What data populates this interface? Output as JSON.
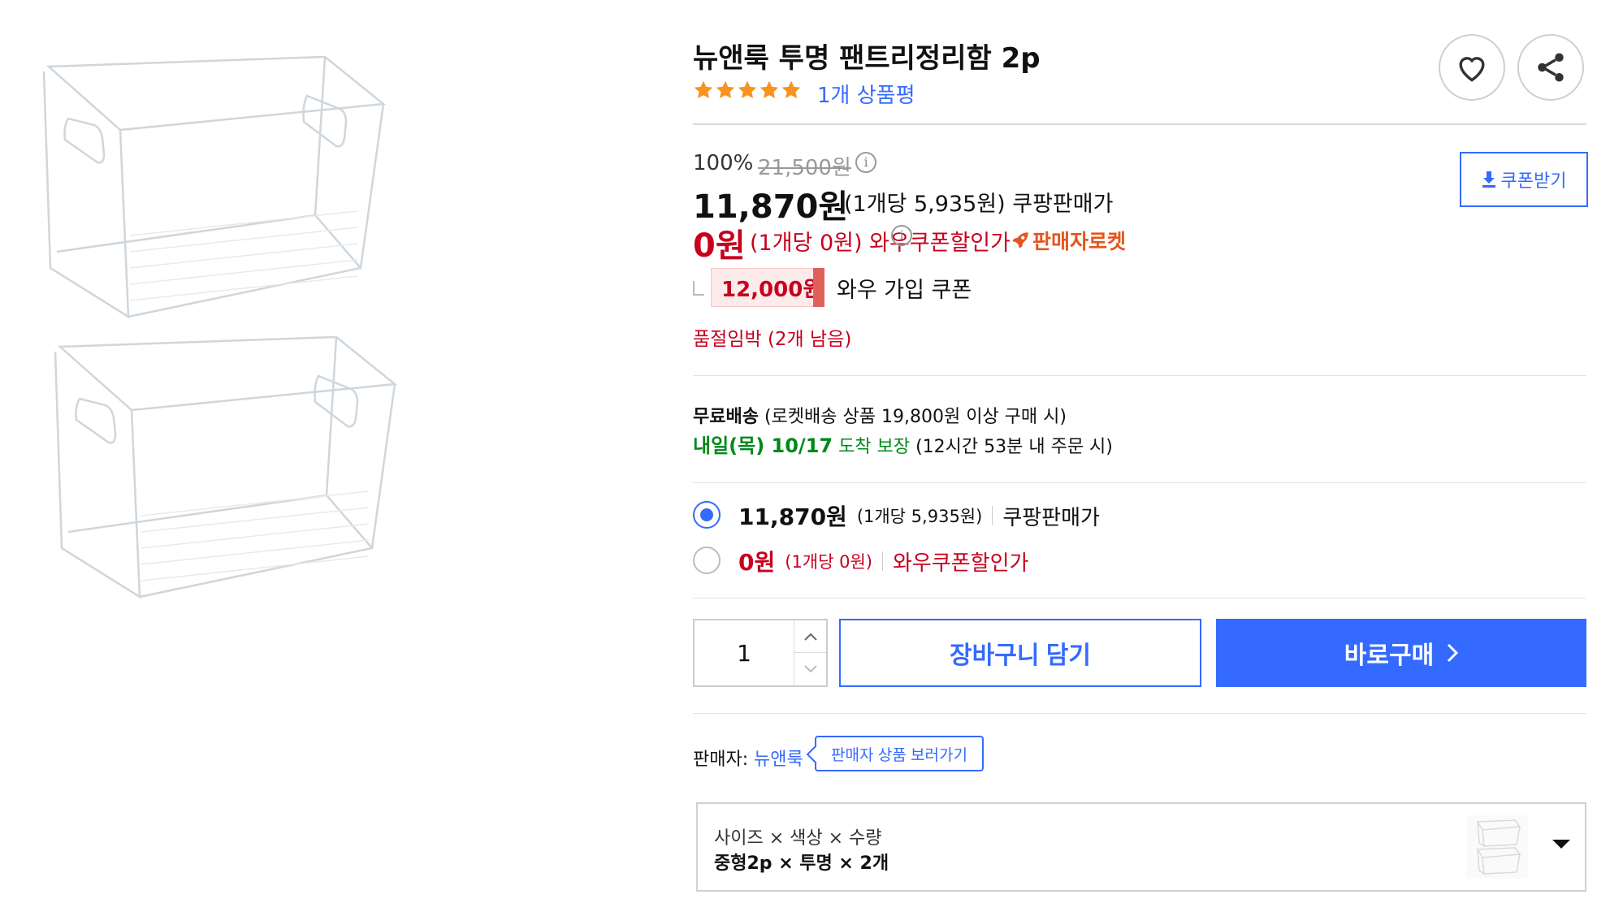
{
  "product": {
    "title": "뉴앤룩 투명 팬트리정리함 2p",
    "review_count_label": "1개 상품평",
    "rating": 5
  },
  "actions": {
    "like_icon": "heart-icon",
    "share_icon": "share-icon"
  },
  "pricing": {
    "discount_rate": "100%",
    "original_price": "21,500원",
    "sale_price": "11,870원",
    "sale_unit_price": "(1개당 5,935원) 쿠팡판매가",
    "wow_price": "0원",
    "wow_unit_price": "(1개당 0원) 와우쿠폰할인가",
    "rocket_badge": "판매자로켓",
    "coupon_button": "쿠폰받기",
    "wow_coupon_amount": "12,000원",
    "wow_coupon_label": "와우 가입 쿠폰",
    "stock_notice": "품절임박 (2개 남음)"
  },
  "shipping": {
    "free_label": "무료배송",
    "free_condition": "(로켓배송 상품 19,800원 이상 구매 시)",
    "arrival_date": "내일(목) 10/17",
    "arrival_guarantee": "도착 보장",
    "order_deadline": "(12시간 53분 내 주문 시)"
  },
  "price_options": [
    {
      "price": "11,870원",
      "unit": "(1개당 5,935원)",
      "label": "쿠팡판매가",
      "selected": true,
      "color": "#111111"
    },
    {
      "price": "0원",
      "unit": "(1개당 0원)",
      "label": "와우쿠폰할인가",
      "selected": false,
      "color": "#c6001e"
    }
  ],
  "purchase": {
    "quantity": "1",
    "cart_button": "장바구니 담기",
    "buy_button": "바로구매"
  },
  "seller": {
    "label": "판매자:",
    "name": "뉴앤룩",
    "store_button": "판매자 상품 보러가기"
  },
  "option_selector": {
    "header": "사이즈 × 색상 × 수량",
    "value": "중형2p × 투명 × 2개"
  },
  "colors": {
    "accent_blue": "#346aff",
    "sale_red": "#c6001e",
    "rocket_orange": "#e3561d",
    "guarantee_green": "#00891a",
    "star_orange": "#f7931e"
  }
}
